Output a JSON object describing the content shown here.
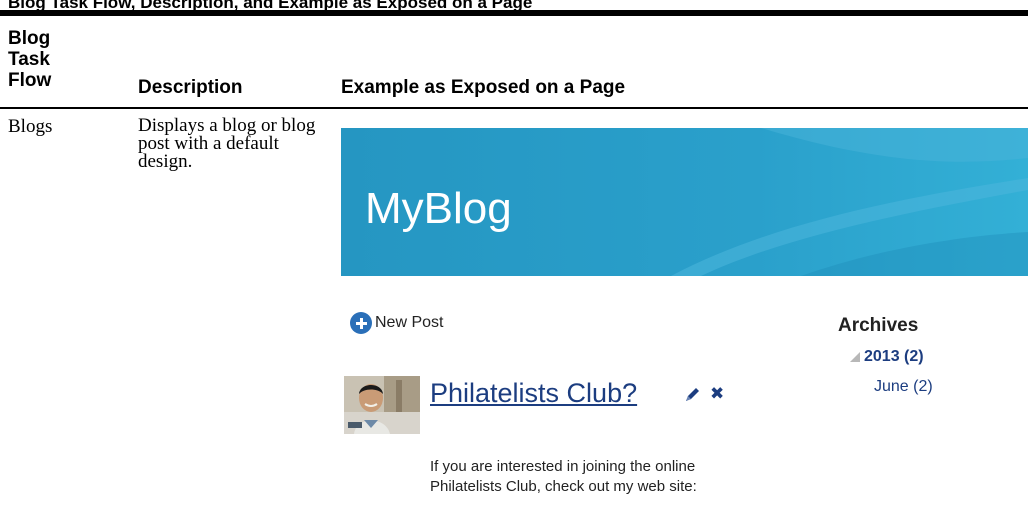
{
  "top_caption": "Blog Task Flow, Description, and Example as Exposed on a Page",
  "table": {
    "headers": [
      "Blog Task Flow",
      "Description",
      "Example as Exposed on a Page"
    ],
    "rows": [
      {
        "name": "Blogs",
        "description": "Displays a blog or blog post with a default design."
      }
    ]
  },
  "example": {
    "banner_title": "MyBlog",
    "new_post_label": "New Post",
    "post": {
      "title": "Philatelists Club?",
      "body": "If you are interested in joining the online Philatelists Club, check out my web site:"
    },
    "archives": {
      "title": "Archives",
      "year": "2013 (2)",
      "month": "June (2)"
    }
  },
  "colors": {
    "banner": "#2a9ec8",
    "link": "#1c3d80",
    "new_post_icon": "#2a6fb8"
  },
  "icons": [
    "new-post-plus-icon",
    "edit-pencil-icon",
    "delete-x-icon",
    "expand-triangle-icon"
  ]
}
